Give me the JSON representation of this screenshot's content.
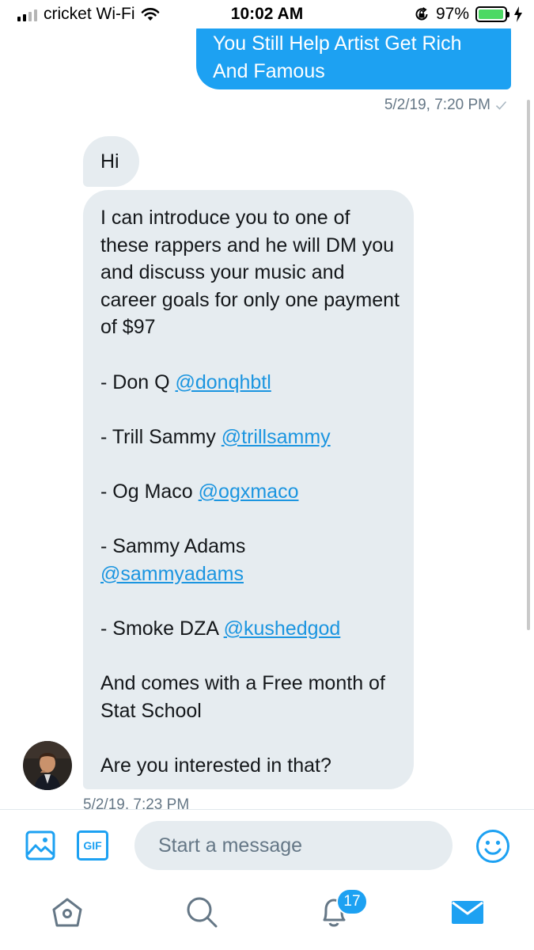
{
  "status_bar": {
    "carrier": "cricket Wi-Fi",
    "time": "10:02 AM",
    "battery_percent": "97%",
    "battery_level": 0.97,
    "signal_bars_active": 2,
    "icons": [
      "signal-icon",
      "wifi-icon",
      "orientation-lock-icon",
      "battery-icon",
      "charging-icon"
    ]
  },
  "conversation": {
    "outgoing": {
      "text": "You Still Help Artist Get Rich And Famous",
      "timestamp": "5/2/19, 7:20 PM"
    },
    "incoming": [
      {
        "text": "Hi"
      },
      {
        "intro": "I can introduce you to one of these rappers and he will DM you and discuss your music and career goals for only one payment of $97",
        "items": [
          {
            "prefix": "- Don Q",
            "handle": "@donqhbtl"
          },
          {
            "prefix": "- Trill Sammy",
            "handle": "@trillsammy"
          },
          {
            "prefix": "- Og Maco",
            "handle": "@ogxmaco"
          },
          {
            "prefix": "- Sammy Adams",
            "handle": "@sammyadams"
          },
          {
            "prefix": "- Smoke DZA",
            "handle": "@kushedgod"
          }
        ],
        "offer": "And comes with a Free month of Stat School",
        "question": "Are you interested in that?"
      }
    ],
    "incoming_timestamp": "5/2/19, 7:23 PM"
  },
  "composer": {
    "gif_label": "GIF",
    "placeholder": "Start a message"
  },
  "tab_bar": {
    "notifications_badge": "17"
  },
  "colors": {
    "accent": "#1da1f2",
    "bubble_incoming": "#e6ecf0",
    "link": "#1b95e0",
    "muted_text": "#657786"
  }
}
